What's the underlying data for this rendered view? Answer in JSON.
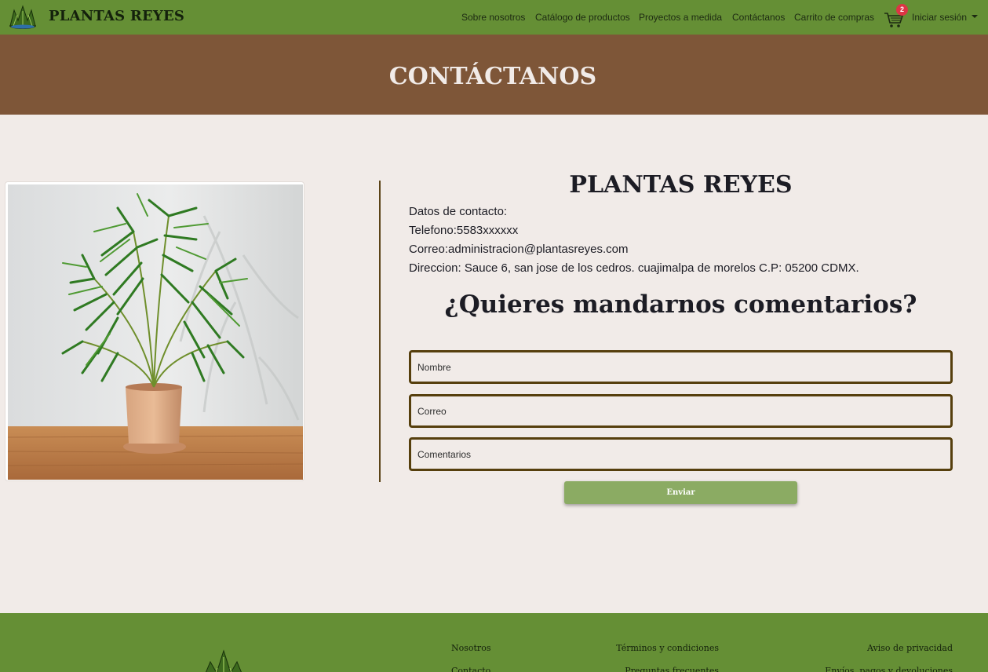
{
  "navbar": {
    "brand": "PLANTAS REYES",
    "links": {
      "about": "Sobre nosotros",
      "catalog": "Catálogo de productos",
      "custom": "Proyectos a medida",
      "contact": "Contáctanos",
      "cart": "Carrito de compras",
      "login": "Iniciar sesión"
    },
    "cart_count": "2"
  },
  "banner": {
    "title": "CONTÁCTANOS"
  },
  "contact": {
    "company": "PLANTAS REYES",
    "heading": "Datos de contacto:",
    "phone": "Telefono:5583xxxxxx",
    "email": "Correo:administracion@plantasreyes.com",
    "address": "Direccion: Sauce 6, san jose de los cedros. cuajimalpa de morelos C.P: 05200 CDMX."
  },
  "form": {
    "title": "¿Quieres mandarnos comentarios?",
    "name_placeholder": "Nombre",
    "email_placeholder": "Correo",
    "comments_placeholder": "Comentarios",
    "submit_label": "Enviar"
  },
  "footer": {
    "col1": [
      "Nosotros",
      "Contacto"
    ],
    "col2": [
      "Términos y condiciones",
      "Preguntas frecuentes"
    ],
    "col3": [
      "Aviso de privacidad",
      "Envíos, pagos y devoluciones"
    ]
  },
  "colors": {
    "navbar": "#658f35",
    "banner": "#7e5638",
    "background": "#f1ebe8",
    "field_border": "#563f0d",
    "button": "#8bab63"
  }
}
